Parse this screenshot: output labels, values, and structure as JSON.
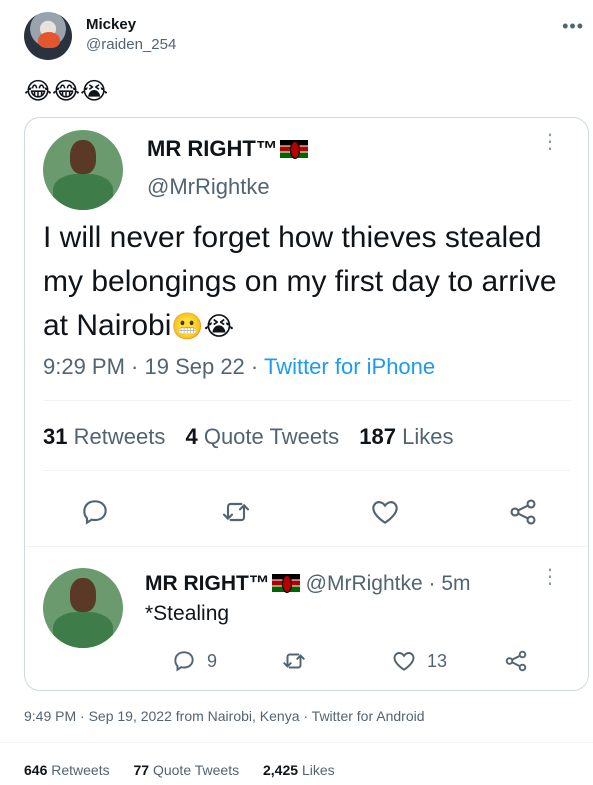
{
  "outer_tweet": {
    "name": "Mickey",
    "handle": "@raiden_254",
    "more_icon": "•••",
    "emojis": "😂😂😭",
    "meta": "9:49 PM · Sep 19, 2022 from Nairobi, Kenya · Twitter for Android",
    "stats": {
      "retweets_count": "646",
      "retweets_label": "Retweets",
      "quotes_count": "77",
      "quotes_label": "Quote Tweets",
      "likes_count": "2,425",
      "likes_label": "Likes"
    }
  },
  "quoted_tweet": {
    "name": "MR RIGHT™",
    "handle": "@MrRightke",
    "more_icon": "⋮",
    "text": "I will never forget how thieves stealed my belongings on my first day to arrive at Nairobi",
    "text_emojis": "😬😭",
    "time": "9:29 PM · 19 Sep 22 · ",
    "source": "Twitter for iPhone",
    "stats": {
      "retweets_count": "31",
      "retweets_label": "Retweets",
      "quotes_count": "4",
      "quotes_label": "Quote Tweets",
      "likes_count": "187",
      "likes_label": "Likes"
    },
    "actions": [
      "reply-icon",
      "retweet-icon",
      "like-icon",
      "share-icon"
    ]
  },
  "reply": {
    "name": "MR RIGHT™",
    "handle_time": "@MrRightke · 5m",
    "more_icon": "⋮",
    "text": "*Stealing",
    "reply_count": "9",
    "like_count": "13"
  },
  "colors": {
    "text": "#0f1419",
    "secondary": "#536471",
    "link": "#1d9bf0",
    "border": "#cfd9de"
  }
}
